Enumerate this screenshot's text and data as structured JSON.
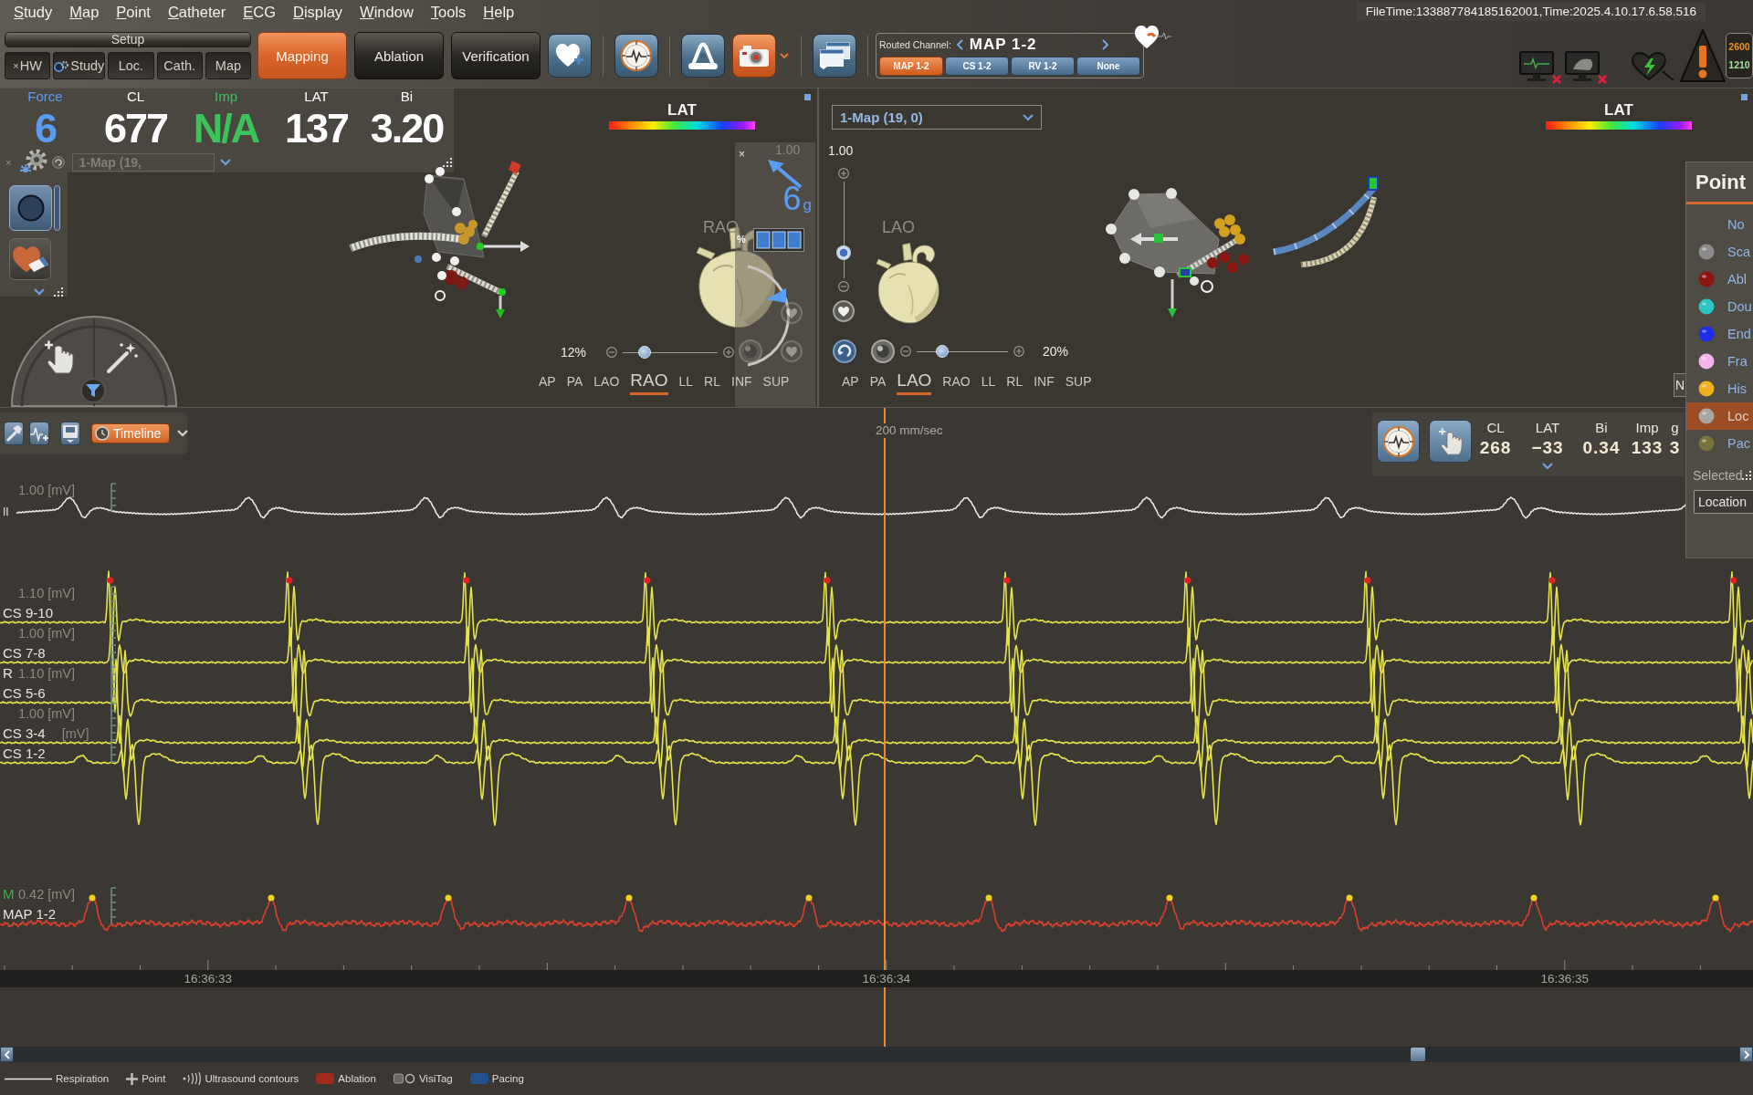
{
  "menu": [
    {
      "label": "Study",
      "mnemonic": true
    },
    {
      "label": "Map",
      "mnemonic": true
    },
    {
      "label": "Point",
      "mnemonic": true
    },
    {
      "label": "Catheter",
      "mnemonic": true
    },
    {
      "label": "ECG",
      "mnemonic": true
    },
    {
      "label": "Display",
      "mnemonic": true
    },
    {
      "label": "Window",
      "mnemonic": true
    },
    {
      "label": "Tools",
      "mnemonic": true
    },
    {
      "label": "Help",
      "mnemonic": true
    }
  ],
  "file_time": "FileTime:133887784185162001,Time:2025.4.10.17.6.58.516",
  "setup": {
    "title": "Setup",
    "tabs": [
      {
        "label": "HW",
        "close": "×",
        "status_icon": false,
        "selected": false
      },
      {
        "label": "Study",
        "status_icon": true,
        "selected": false
      },
      {
        "label": "Loc.",
        "status_icon": false,
        "selected": false
      },
      {
        "label": "Cath.",
        "status_icon": false,
        "selected": false
      },
      {
        "label": "Map",
        "status_icon": false,
        "selected": false
      }
    ]
  },
  "modes": [
    {
      "label": "Mapping",
      "selected": true
    },
    {
      "label": "Ablation",
      "selected": false
    },
    {
      "label": "Verification",
      "selected": false
    }
  ],
  "tool_buttons": [
    {
      "kind": "heart-plus",
      "active": false
    },
    {
      "kind": "compass",
      "active": false
    },
    {
      "kind": "arch",
      "active": false
    },
    {
      "kind": "camera",
      "active": true
    },
    {
      "kind": "caret",
      "active": false
    },
    {
      "kind": "windows",
      "active": false
    }
  ],
  "routed_channel": {
    "label": "Routed Channel:",
    "value": "MAP 1-2",
    "options": [
      {
        "label": "MAP 1-2",
        "selected": true
      },
      {
        "label": "CS 1-2",
        "selected": false
      },
      {
        "label": "RV 1-2",
        "selected": false
      },
      {
        "label": "None",
        "selected": false
      }
    ]
  },
  "alert_counts": [
    {
      "value": "2600",
      "color": "#f0921e"
    },
    {
      "value": "1210",
      "color": "#a3e0a0"
    }
  ],
  "left_view": {
    "readings": [
      {
        "label": "Force",
        "value": "6",
        "color": "#5b9cf2"
      },
      {
        "label": "CL",
        "value": "677",
        "color": "#ffffff"
      },
      {
        "label": "Imp",
        "value": "N/A",
        "color": "#3cc25a"
      },
      {
        "label": "LAT",
        "value": "137",
        "color": "#ffffff"
      },
      {
        "label": "Bi",
        "value": "3.20",
        "color": "#ffffff"
      }
    ],
    "map_select": "1-Map (19,",
    "close": "×",
    "legend_title": "LAT",
    "force": {
      "close": "×",
      "scale": "1.00",
      "value": "6",
      "unit": "g",
      "percent": "%"
    },
    "orientation": "RAO",
    "zoom": {
      "reading": "12%",
      "level": 0.19
    },
    "views": [
      {
        "label": "AP",
        "selected": false
      },
      {
        "label": "PA",
        "selected": false
      },
      {
        "label": "LAO",
        "selected": false
      },
      {
        "label": "RAO",
        "selected": true
      },
      {
        "label": "LL",
        "selected": false
      },
      {
        "label": "RL",
        "selected": false
      },
      {
        "label": "INF",
        "selected": false
      },
      {
        "label": "SUP",
        "selected": false
      }
    ]
  },
  "right_view": {
    "map_select": "1-Map (19, 0)",
    "scale": "1.00",
    "scale_slider": {
      "level": 0.22
    },
    "orientation": "LAO",
    "legend_title": "LAT",
    "zoom": {
      "reading": "20%",
      "level": 0.24
    },
    "views": [
      {
        "label": "AP",
        "selected": false
      },
      {
        "label": "PA",
        "selected": false
      },
      {
        "label": "LAO",
        "selected": true
      },
      {
        "label": "RAO",
        "selected": false
      },
      {
        "label": "LL",
        "selected": false
      },
      {
        "label": "RL",
        "selected": false
      },
      {
        "label": "INF",
        "selected": false
      },
      {
        "label": "SUP",
        "selected": false
      }
    ],
    "side_button": "N"
  },
  "points_panel": {
    "title": "Point",
    "types": [
      {
        "label": "No",
        "selected": false
      },
      {
        "label": "Sca",
        "color": "#8c8c8a",
        "selected": false
      },
      {
        "label": "Abl",
        "color": "#8e1410",
        "selected": false
      },
      {
        "label": "Dou",
        "color": "#2ec4c0",
        "selected": false
      },
      {
        "label": "End",
        "color": "#1e2ee8",
        "selected": false
      },
      {
        "label": "Fra",
        "color": "#f4b4ec",
        "selected": false
      },
      {
        "label": "His",
        "color": "#f0b020",
        "selected": false
      },
      {
        "label": "Loc",
        "color": "#a8a6a2",
        "selected": true
      },
      {
        "label": "Pac",
        "color": "#77733a",
        "selected": false
      }
    ],
    "status": "Selected",
    "button": "Location"
  },
  "waveforms": {
    "toolbar_button": "Timeline",
    "speed": "200 mm/sec",
    "readings": [
      {
        "label": "CL",
        "value": "268",
        "expandable": false
      },
      {
        "label": "LAT",
        "value": "−33",
        "expandable": true
      },
      {
        "label": "Bi",
        "value": "0.34",
        "expandable": false
      },
      {
        "label": "Imp",
        "value": "133",
        "expandable": false
      },
      {
        "label": "g",
        "value": "3",
        "expandable": false
      }
    ],
    "channels": [
      {
        "name": "II",
        "scale": "1.00 [mV]",
        "color": "#e8e6de",
        "kind": "surface"
      },
      {
        "name": "CS 9-10",
        "scale": "1.10 [mV]",
        "color": "#e6e44a",
        "kind": "cs"
      },
      {
        "name": "CS 7-8",
        "scale": "1.00 [mV]",
        "color": "#e6e44a",
        "kind": "cs"
      },
      {
        "name": "CS 5-6",
        "tag": "R",
        "scale": "1.10 [mV]",
        "color": "#e6e44a",
        "kind": "cs"
      },
      {
        "name": "CS 3-4",
        "scale": "1.00 [mV]",
        "color": "#e6e44a",
        "kind": "cs"
      },
      {
        "name": "CS 1-2",
        "scale": "[mV]",
        "color": "#e6e44a",
        "kind": "cs"
      },
      {
        "name": "MAP 1-2",
        "tag": "M",
        "scale": "0.42 [mV]",
        "color": "#d8402e",
        "kind": "map"
      }
    ],
    "time_labels": [
      "16:36:33",
      "16:36:34",
      "16:36:35"
    ]
  },
  "legend": [
    {
      "label": "Respiration",
      "kind": "line"
    },
    {
      "label": "Point",
      "kind": "plus"
    },
    {
      "label": "Ultrasound contours",
      "kind": "waves"
    },
    {
      "label": "Ablation",
      "kind": "swatch",
      "color": "#a02a1e"
    },
    {
      "label": "VisiTag",
      "kind": "visitag"
    },
    {
      "label": "Pacing",
      "kind": "swatch",
      "color": "#23508f"
    }
  ]
}
